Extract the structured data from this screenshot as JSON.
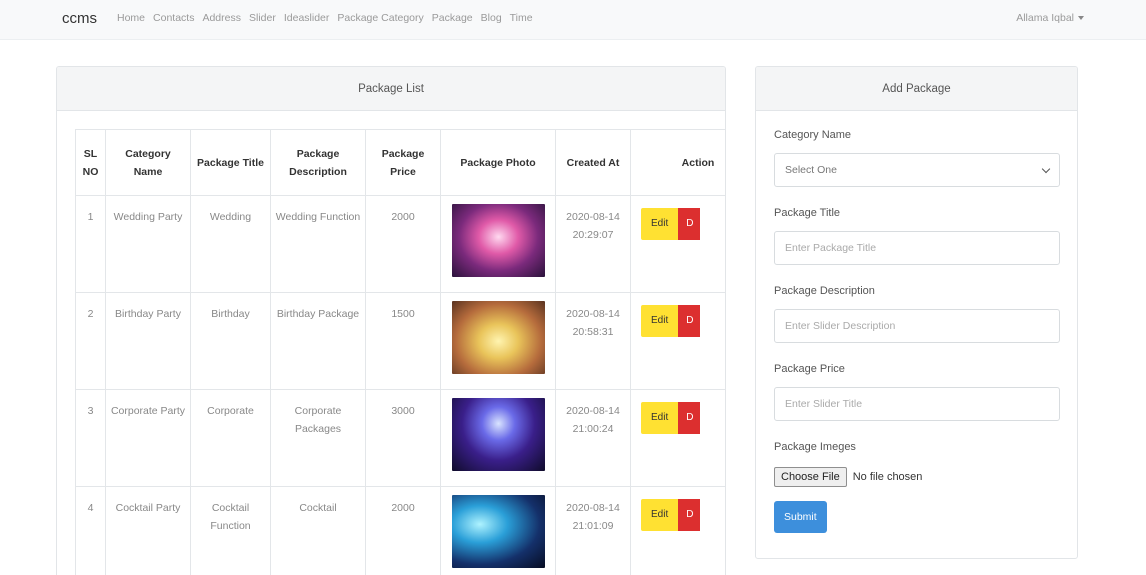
{
  "navbar": {
    "brand": "ccms",
    "links": [
      "Home",
      "Contacts",
      "Address",
      "Slider",
      "Ideaslider",
      "Package Category",
      "Package",
      "Blog",
      "Time"
    ],
    "user": "Allama Iqbal"
  },
  "package_list": {
    "title": "Package List",
    "columns": [
      "SL NO",
      "Category Name",
      "Package Title",
      "Package Description",
      "Package Price",
      "Package Photo",
      "Created At",
      "Action"
    ],
    "rows": [
      {
        "sl": "1",
        "category": "Wedding Party",
        "title": "Wedding",
        "description": "Wedding Function",
        "price": "2000",
        "created": "2020-08-14 20:29:07",
        "photo_icon": "wedding-stage-photo"
      },
      {
        "sl": "2",
        "category": "Birthday Party",
        "title": "Birthday",
        "description": "Birthday Package",
        "price": "1500",
        "created": "2020-08-14 20:58:31",
        "photo_icon": "birthday-hall-photo"
      },
      {
        "sl": "3",
        "category": "Corporate Party",
        "title": "Corporate",
        "description": "Corporate Packages",
        "price": "3000",
        "created": "2020-08-14 21:00:24",
        "photo_icon": "corporate-event-photo"
      },
      {
        "sl": "4",
        "category": "Cocktail Party",
        "title": "Cocktail Function",
        "description": "Cocktail",
        "price": "2000",
        "created": "2020-08-14 21:01:09",
        "photo_icon": "cocktail-party-photo"
      }
    ],
    "edit_label": "Edit",
    "delete_label": "D"
  },
  "add_package": {
    "title": "Add Package",
    "category_label": "Category Name",
    "category_selected": "Select One",
    "title_label": "Package Title",
    "title_placeholder": "Enter Package Title",
    "description_label": "Package Description",
    "description_placeholder": "Enter Slider Description",
    "price_label": "Package Price",
    "price_placeholder": "Enter Slider Title",
    "images_label": "Package Imeges",
    "file_button": "Choose File",
    "file_status": "No file chosen",
    "submit_label": "Submit"
  },
  "colors": {
    "edit_button": "#ffe132",
    "delete_button": "#dc2f2f",
    "submit_button": "#3d8fdc"
  }
}
